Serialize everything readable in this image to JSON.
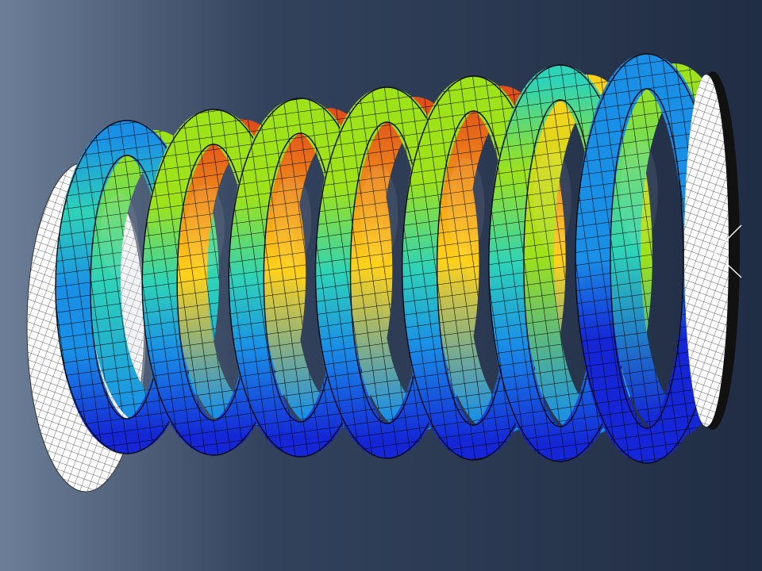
{
  "scene": {
    "subject": "fea-helical-spring-contour",
    "coil_count": 7,
    "stress_colors": {
      "low": "#1426d6",
      "low_mid": "#1a8fe6",
      "mid": "#2fd3b8",
      "mid_high": "#9ee21a",
      "high": "#ffd21a",
      "max": "#e0501a"
    },
    "coil_peak_levels": [
      0.35,
      0.62,
      0.7,
      0.72,
      0.66,
      0.58,
      0.2
    ],
    "background": {
      "left": "#6d7f98",
      "right": "#202d44"
    },
    "mesh_color": "#000000",
    "end_plate_color": "#ffffff"
  }
}
